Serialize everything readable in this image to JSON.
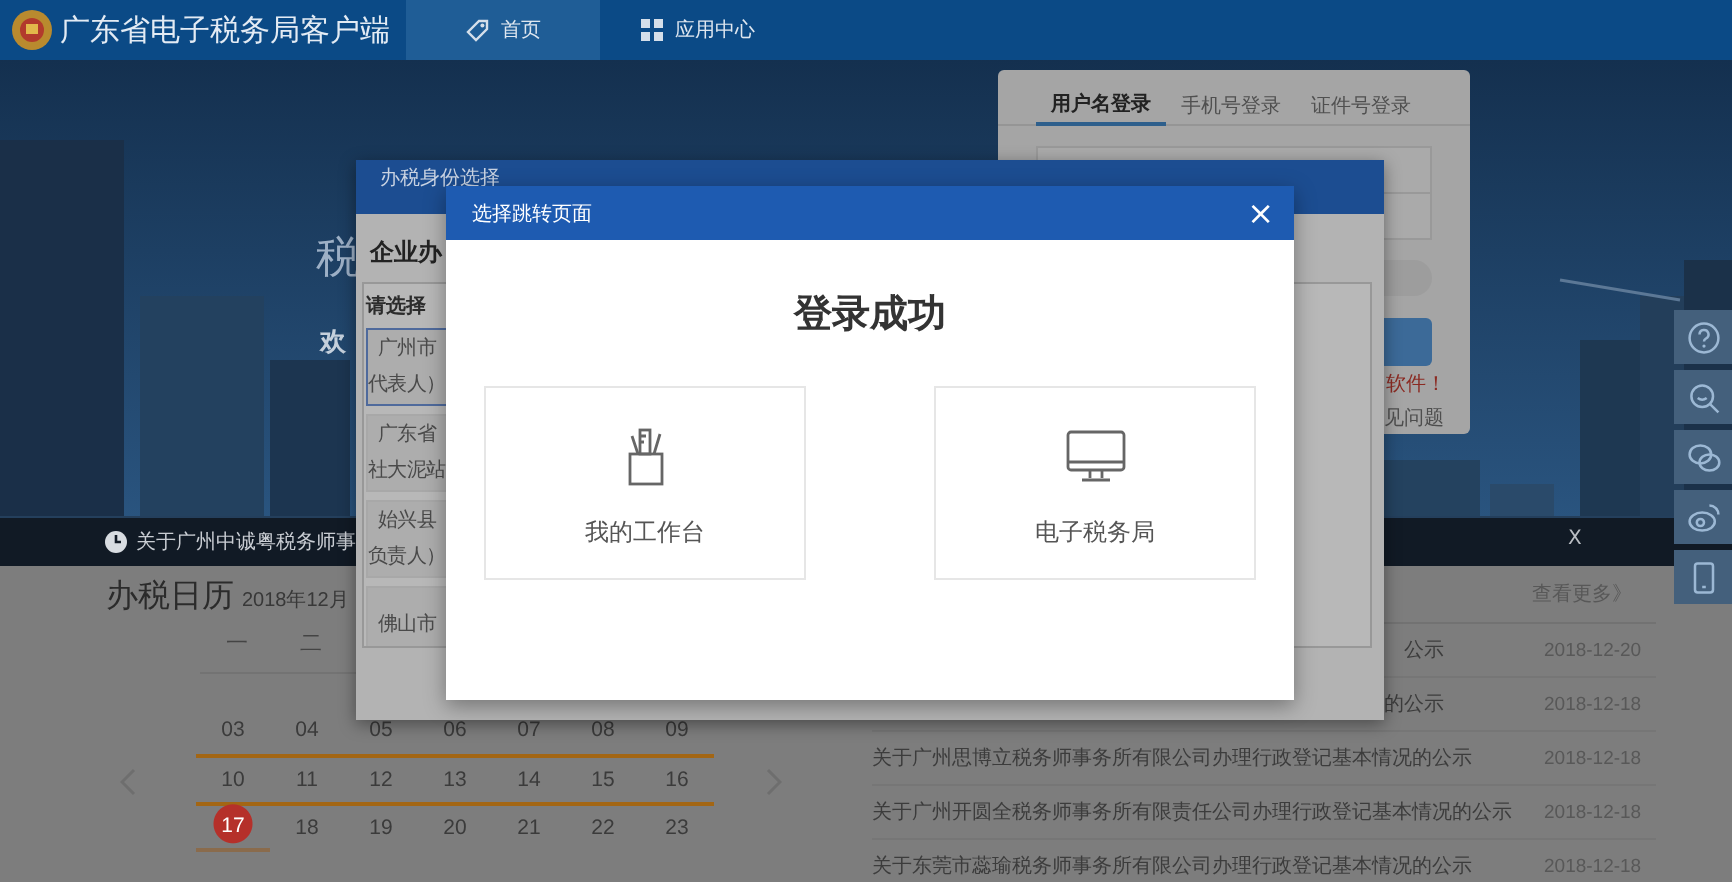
{
  "header": {
    "title": "广东省电子税务局客户端",
    "tabs": [
      {
        "label": "首页",
        "selected": true
      },
      {
        "label": "应用中心",
        "selected": false
      }
    ]
  },
  "banner": {
    "title": "税",
    "greeting": "欢",
    "notice": "关于广州中诚粤税务师事",
    "notice_close": "X"
  },
  "login": {
    "tabs": [
      {
        "label": "用户名登录",
        "selected": true
      },
      {
        "label": "手机号登录",
        "selected": false
      },
      {
        "label": "证件号登录",
        "selected": false
      }
    ],
    "warning": "软件！",
    "help": "见问题"
  },
  "calendar": {
    "title": "办税日历",
    "month": "2018年12月",
    "weekdays": [
      "一",
      "二"
    ],
    "weeks": [
      {
        "highlighted": true,
        "days": [
          {
            "text": "03",
            "today": false
          },
          {
            "text": "04",
            "today": false
          },
          {
            "text": "05",
            "today": false
          },
          {
            "text": "06",
            "today": false
          },
          {
            "text": "07",
            "today": false
          },
          {
            "text": "08",
            "today": false
          },
          {
            "text": "09",
            "today": false
          }
        ]
      },
      {
        "highlighted": true,
        "days": [
          {
            "text": "10",
            "today": false
          },
          {
            "text": "11",
            "today": false
          },
          {
            "text": "12",
            "today": false
          },
          {
            "text": "13",
            "today": false
          },
          {
            "text": "14",
            "today": false
          },
          {
            "text": "15",
            "today": false
          },
          {
            "text": "16",
            "today": false
          }
        ]
      },
      {
        "highlighted": false,
        "days": [
          {
            "text": "17",
            "today": true
          },
          {
            "text": "18",
            "today": false
          },
          {
            "text": "19",
            "today": false
          },
          {
            "text": "20",
            "today": false
          },
          {
            "text": "21",
            "today": false
          },
          {
            "text": "22",
            "today": false
          },
          {
            "text": "23",
            "today": false
          }
        ]
      }
    ]
  },
  "news": {
    "more": "查看更多》",
    "items": [
      {
        "title": "公示",
        "date": "2018-12-20",
        "kind": "cut"
      },
      {
        "title": "的公示",
        "date": "2018-12-18",
        "kind": "cut"
      },
      {
        "title": "关于广州思博立税务师事务所有限公司办理行政登记基本情况的公示",
        "date": "2018-12-18",
        "kind": "full"
      },
      {
        "title": "关于广州开圆全税务师事务所有限责任公司办理行政登记基本情况的公示",
        "date": "2018-12-18",
        "kind": "full"
      },
      {
        "title": "关于东莞市蕊瑜税务师事务所有限公司办理行政登记基本情况的公示",
        "date": "2018-12-18",
        "kind": "full"
      }
    ]
  },
  "identity_dialog": {
    "title": "办税身份选择",
    "heading": "企业办",
    "prompt": "请选择",
    "options": [
      {
        "lines": [
          "广州市",
          "代表人）"
        ],
        "selected": true
      },
      {
        "lines": [
          "广东省",
          "社大泥站"
        ],
        "selected": false
      },
      {
        "lines": [
          "始兴县",
          "负责人）"
        ],
        "selected": false
      },
      {
        "lines": [
          "佛山市"
        ],
        "selected": false
      }
    ]
  },
  "jump_dialog": {
    "title": "选择跳转页面",
    "close": "×",
    "message": "登录成功",
    "choices": [
      {
        "label": "我的工作台"
      },
      {
        "label": "电子税务局"
      }
    ]
  }
}
